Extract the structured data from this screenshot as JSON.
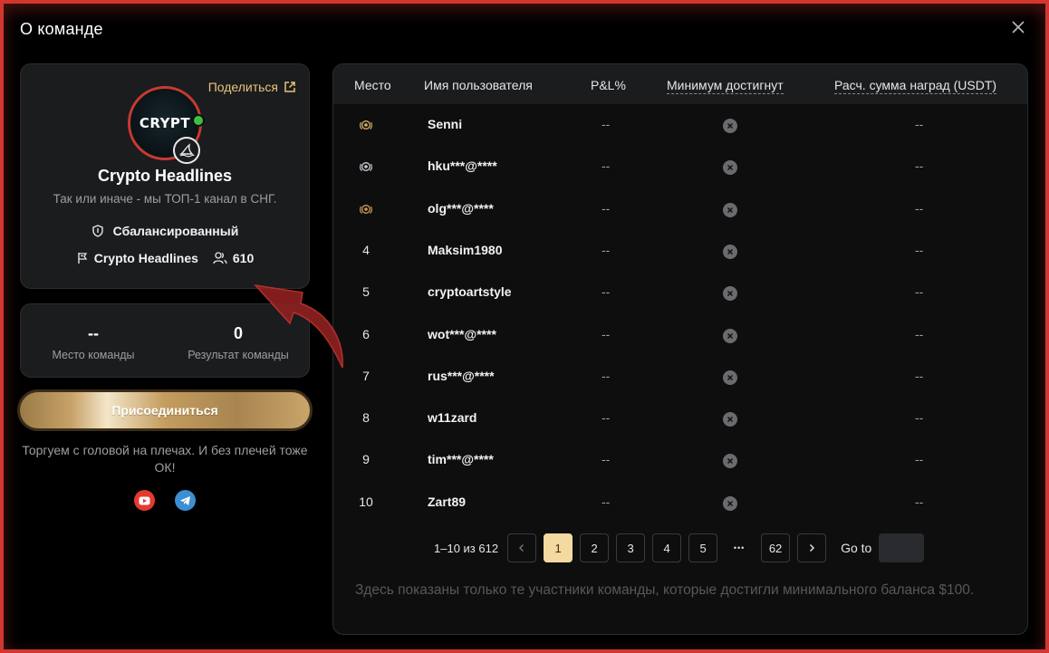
{
  "modal": {
    "title": "О команде"
  },
  "team": {
    "share_label": "Поделиться",
    "avatar_text": "CRYPT",
    "name": "Crypto Headlines",
    "description": "Так или иначе - мы ТОП-1 канал в СНГ.",
    "strategy": "Сбалансированный",
    "channel": "Crypto Headlines",
    "members": "610"
  },
  "stats": {
    "rank_value": "--",
    "rank_label": "Место команды",
    "result_value": "0",
    "result_label": "Результат команды"
  },
  "join_label": "Присоединиться",
  "slogan": "Торгуем с головой на плечах. И без плечей тоже ОК!",
  "colors": {
    "accent_gold": "#e8c37b",
    "frame_red": "#d2372f",
    "youtube": "#e53a2f",
    "telegram": "#3c8fd2"
  },
  "table": {
    "headers": {
      "rank": "Место",
      "user": "Имя пользователя",
      "pnl": "P&L%",
      "min": "Минимум достигнут",
      "reward": "Расч. сумма наград (USDT)"
    },
    "rows": [
      {
        "rank": "",
        "medal": "gold-medal-icon",
        "user": "Senni",
        "pnl": "--",
        "reward": "--"
      },
      {
        "rank": "",
        "medal": "silver-medal-icon",
        "user": "hku***@****",
        "pnl": "--",
        "reward": "--"
      },
      {
        "rank": "",
        "medal": "bronze-medal-icon",
        "user": "olg***@****",
        "pnl": "--",
        "reward": "--"
      },
      {
        "rank": "4",
        "user": "Maksim1980",
        "pnl": "--",
        "reward": "--"
      },
      {
        "rank": "5",
        "user": "cryptoartstyle",
        "pnl": "--",
        "reward": "--"
      },
      {
        "rank": "6",
        "user": "wot***@****",
        "pnl": "--",
        "reward": "--"
      },
      {
        "rank": "7",
        "user": "rus***@****",
        "pnl": "--",
        "reward": "--"
      },
      {
        "rank": "8",
        "user": "w11zard",
        "pnl": "--",
        "reward": "--"
      },
      {
        "rank": "9",
        "user": "tim***@****",
        "pnl": "--",
        "reward": "--"
      },
      {
        "rank": "10",
        "user": "Zart89",
        "pnl": "--",
        "reward": "--"
      }
    ]
  },
  "pagination": {
    "summary": "1–10 из 612",
    "pages": [
      "1",
      "2",
      "3",
      "4",
      "5"
    ],
    "ellipsis": "•••",
    "last": "62",
    "goto_label": "Go to"
  },
  "note": "Здесь показаны только те участники команды, которые достигли минимального баланса $100."
}
